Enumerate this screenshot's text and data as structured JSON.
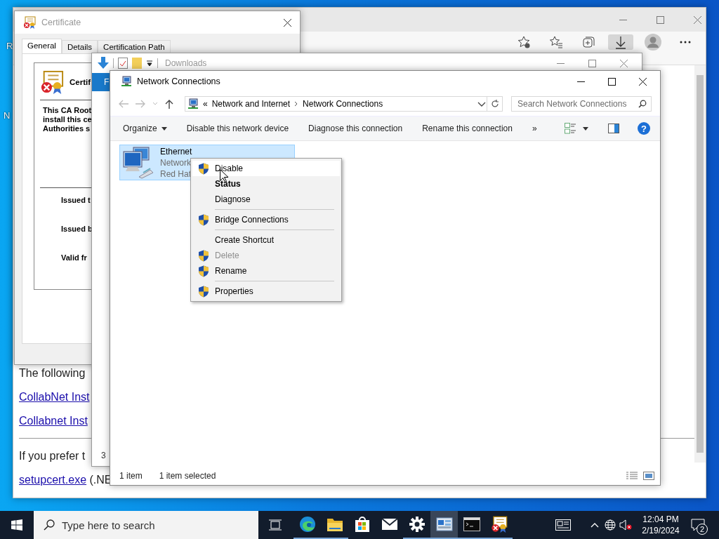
{
  "desktop_icons": [
    {
      "label": "R"
    },
    {
      "label": "N"
    }
  ],
  "browser": {
    "downloads_active": true,
    "page": {
      "paragraph_1": "The following",
      "links": [
        "CollabNet Inst",
        "Collabnet Inst"
      ],
      "paragraph_2": "If you prefer t",
      "file_link": "setupcert.exe",
      "file_note": "(.NE"
    }
  },
  "certificate_window": {
    "title": "Certificate",
    "tabs": [
      {
        "label": "General",
        "selected": true
      },
      {
        "label": "Details",
        "selected": false
      },
      {
        "label": "Certification Path",
        "selected": false
      }
    ],
    "heading": "Certif",
    "warning_lines": [
      "This CA Root",
      "install this ce",
      "Authorities s"
    ],
    "fields": [
      "Issued t",
      "Issued b",
      "Valid fr"
    ]
  },
  "downloads_window": {
    "title": "Downloads",
    "ribbon_tab": "F",
    "status": "3"
  },
  "network_window": {
    "title": "Network Connections",
    "address": {
      "overflow": "«",
      "crumbs": [
        "Network and Internet",
        "Network Connections"
      ]
    },
    "search_placeholder": "Search Network Connections",
    "commands": [
      {
        "label": "Organize",
        "dropdown": true
      },
      {
        "label": "Disable this network device",
        "dropdown": false
      },
      {
        "label": "Diagnose this connection",
        "dropdown": false
      },
      {
        "label": "Rename this connection",
        "dropdown": false
      }
    ],
    "more": "»",
    "help": "?",
    "items": [
      {
        "name": "Ethernet",
        "lines": [
          "Network",
          "Red Hat"
        ],
        "selected": true
      }
    ],
    "status": {
      "count": "1 item",
      "selection": "1 item selected"
    }
  },
  "context_menu": {
    "items": [
      {
        "kind": "item",
        "label": "Disable",
        "shield": true,
        "highlighted": true,
        "bold": false,
        "disabled": false
      },
      {
        "kind": "item",
        "label": "Status",
        "shield": false,
        "highlighted": false,
        "bold": true,
        "disabled": false
      },
      {
        "kind": "item",
        "label": "Diagnose",
        "shield": false,
        "highlighted": false,
        "bold": false,
        "disabled": false
      },
      {
        "kind": "separator"
      },
      {
        "kind": "item",
        "label": "Bridge Connections",
        "shield": true,
        "highlighted": false,
        "bold": false,
        "disabled": false
      },
      {
        "kind": "separator"
      },
      {
        "kind": "item",
        "label": "Create Shortcut",
        "shield": false,
        "highlighted": false,
        "bold": false,
        "disabled": false
      },
      {
        "kind": "item",
        "label": "Delete",
        "shield": true,
        "highlighted": false,
        "bold": false,
        "disabled": true
      },
      {
        "kind": "item",
        "label": "Rename",
        "shield": true,
        "highlighted": false,
        "bold": false,
        "disabled": false
      },
      {
        "kind": "separator"
      },
      {
        "kind": "item",
        "label": "Properties",
        "shield": true,
        "highlighted": false,
        "bold": false,
        "disabled": false
      }
    ]
  },
  "taskbar": {
    "search_placeholder": "Type here to search",
    "apps": [
      {
        "kind": "edge",
        "running": true,
        "active": false
      },
      {
        "kind": "explorer",
        "running": true,
        "active": false
      },
      {
        "kind": "store",
        "running": false,
        "active": false
      },
      {
        "kind": "mail",
        "running": false,
        "active": false
      },
      {
        "kind": "settings",
        "running": true,
        "active": false
      },
      {
        "kind": "network",
        "running": true,
        "active": true
      },
      {
        "kind": "terminal",
        "running": true,
        "active": false
      },
      {
        "kind": "certificate",
        "running": true,
        "active": false
      }
    ],
    "time": "12:04 PM",
    "date": "2/19/2024",
    "notification_count": "2"
  }
}
